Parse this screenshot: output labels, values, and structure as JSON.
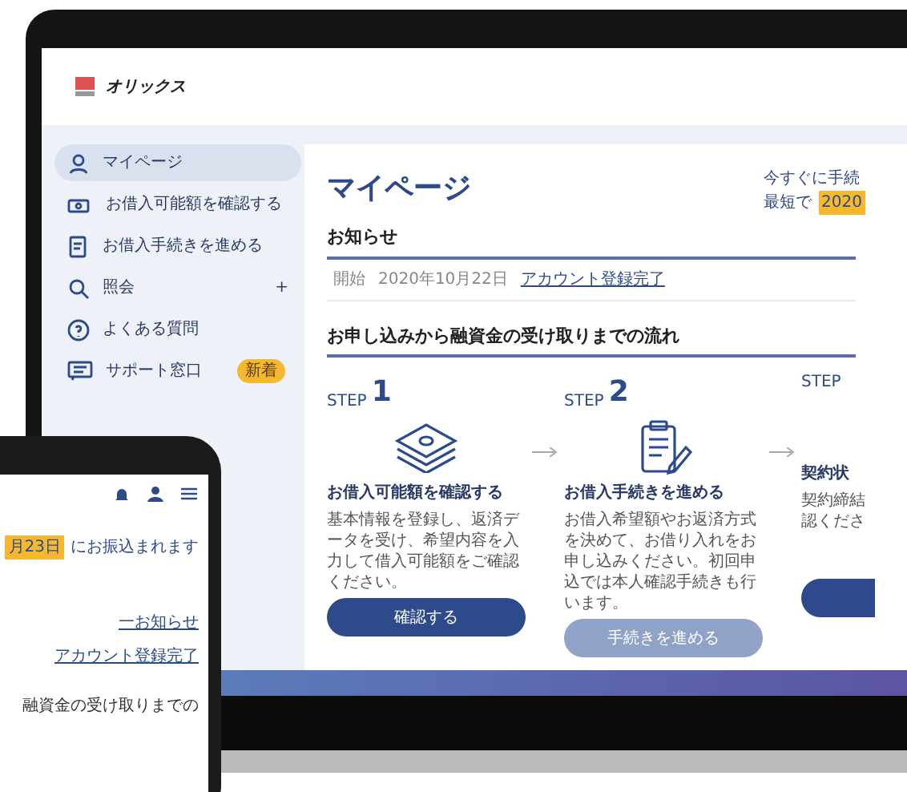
{
  "logo": {
    "text": "オリックス"
  },
  "sidebar": {
    "items": [
      {
        "label": "マイページ",
        "selected": true
      },
      {
        "label": "お借入可能額を確認する",
        "selected": false
      },
      {
        "label": "お借入手続きを進める",
        "selected": false
      },
      {
        "label": "照会",
        "selected": false,
        "toggle": "+"
      },
      {
        "label": "よくある質問",
        "selected": false
      },
      {
        "label": "サポート窓口",
        "selected": false,
        "badge": "新着"
      }
    ]
  },
  "main": {
    "title": "マイページ",
    "promo": {
      "line_1": "今すぐに手続",
      "line_2": "最短で",
      "date": "2020"
    },
    "notices": {
      "heading": "お知らせ",
      "items": [
        {
          "tag": "開始",
          "date": "2020年10月22日",
          "text": "アカウント登録完了"
        }
      ]
    },
    "flow": {
      "heading": "お申し込みから融資金の受け取りまでの流れ",
      "steps": [
        {
          "step_label": "STEP",
          "number": "1",
          "title": "お借入可能額を確認する",
          "description_lines": [
            "基本情報を登録し、返済データを受け、希望内容を入力して借入可能額をご確認ください。"
          ],
          "button": {
            "label": "確認する",
            "disabled": false
          }
        },
        {
          "step_label": "STEP",
          "number": "2",
          "title": "お借入手続きを進める",
          "description_lines": [
            "お借入希望額やお返済方式を決めて、お借り入れをお申し込みください。初回申込では本人確認手続きも行います。"
          ],
          "button": {
            "label": "手続きを進める",
            "disabled": true
          }
        },
        {
          "step_label": "STEP",
          "title": "契約状",
          "description_lines": [
            "契約締結",
            "認くださ"
          ],
          "button": {
            "disabled": false
          }
        }
      ]
    }
  },
  "phone": {
    "promo_date": "月23日",
    "promo_text": "にお振込まれます",
    "notices_link": "一お知らせ",
    "notice_text": "アカウント登録完了",
    "flow_heading": "融資金の受け取りまでの"
  }
}
